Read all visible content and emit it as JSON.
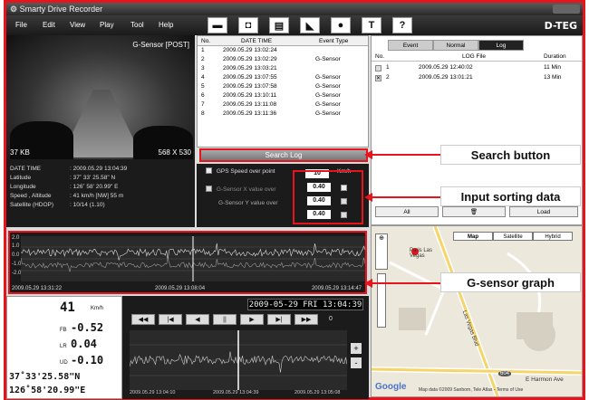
{
  "window": {
    "app_title": "Smarty Drive Recorder",
    "brand": "D-TEG"
  },
  "menu": [
    "File",
    "Edit",
    "View",
    "Play",
    "Tool",
    "Help"
  ],
  "toolbar_icons": [
    "folder-icon",
    "camera-icon",
    "print-icon",
    "flag-icon",
    "disc-icon",
    "pin-icon",
    "help-icon"
  ],
  "toolbar_glyphs": [
    "▬",
    "◘",
    "▤",
    "◣",
    "●",
    "T",
    "?"
  ],
  "video": {
    "channel": "G-Sensor [POST]",
    "size": "37 KB",
    "resolution": "568 X 530"
  },
  "info": {
    "rows": [
      {
        "label": "DATE TIME",
        "value": ": 2009.05.29 13:04:39"
      },
      {
        "label": "Latitude",
        "value": ":  37˚ 33' 25.58\" N"
      },
      {
        "label": "Longitude",
        "value": ":  126˚ 58' 20.99\" E"
      },
      {
        "label": "Speed , Altitude",
        "value": ":  41 km/h  [NW]    55 m"
      },
      {
        "label": "Satellite (HDOP)",
        "value": ":  10/14 (1.10)"
      }
    ]
  },
  "events": {
    "headers": [
      "No.",
      "DATE TIME",
      "Event Type"
    ],
    "rows": [
      {
        "no": "1",
        "dt": "2009.05.29 13:02:24",
        "type": ""
      },
      {
        "no": "2",
        "dt": "2009.05.29 13:02:29",
        "type": "G-Sensor"
      },
      {
        "no": "3",
        "dt": "2009.05.29 13:03:21",
        "type": ""
      },
      {
        "no": "4",
        "dt": "2009.05.29 13:07:55",
        "type": "G-Sensor"
      },
      {
        "no": "5",
        "dt": "2009.05.29 13:07:58",
        "type": "G-Sensor"
      },
      {
        "no": "6",
        "dt": "2009.05.29 13:10:11",
        "type": "G-Sensor"
      },
      {
        "no": "7",
        "dt": "2009.05.29 13:11:08",
        "type": "G-Sensor"
      },
      {
        "no": "8",
        "dt": "2009.05.29 13:11:36",
        "type": "G-Sensor"
      }
    ]
  },
  "search": {
    "label": "Search Log"
  },
  "filters": {
    "speed_label": "GPS Speed over point",
    "speed_value": "10",
    "speed_unit": "Km/h",
    "x_label": "G-Sensor X value over",
    "x_value": "0.40",
    "y_label": "G-Sensor Y value over",
    "y_value": "0.40",
    "z_value": "0.40"
  },
  "log": {
    "tabs": [
      "Event",
      "Normal",
      "Log"
    ],
    "active_tab": "Log",
    "headers": [
      "No.",
      "LOG File",
      "Duration"
    ],
    "rows": [
      {
        "no": "1",
        "file": "2009.05.29 12:40:02",
        "duration": "11 Min",
        "checked": false
      },
      {
        "no": "2",
        "file": "2009.05.29 13:01:21",
        "duration": "13 Min",
        "checked": true
      }
    ],
    "buttons": [
      "All",
      "Load"
    ]
  },
  "graph": {
    "y_ticks": [
      "2.0",
      "1.0",
      "0.0",
      "-1.0",
      "-2.0"
    ],
    "times": [
      "2009.05.29 13:31:22",
      "2009.05.29 13:08:04",
      "2009.05.29 13:14:47"
    ]
  },
  "map": {
    "types": [
      "Map",
      "Satellite",
      "Hybrid"
    ],
    "labels": [
      "Paris Las Vegas",
      "Las Vegas Blvd",
      "E Harmon Ave"
    ],
    "shield": "604",
    "google": "Google",
    "copyright": "Map data ©2009 Sanborn, Tele Atlas - Terms of Use"
  },
  "speed": {
    "value": "41",
    "unit": "Km/h",
    "fb_label": "FB",
    "fb": "-0.52",
    "lr_label": "LR",
    "lr": "0.04",
    "ud_label": "UD",
    "ud": "-0.10",
    "lat": "37˚33'25.58\"N",
    "lon": "126˚58'20.99\"E"
  },
  "player": {
    "clock": "2009-05-29 FRI 13:04:39",
    "buttons": [
      "◀◀",
      "|◀",
      "◀",
      "||",
      "▶",
      "▶|",
      "▶▶"
    ],
    "speed": "0",
    "times": [
      "2009.05.29 13:04:10",
      "2009.05.29 13:04:39",
      "2009.05.29 13:05:08"
    ],
    "zoom": [
      "+",
      "-"
    ]
  },
  "callouts": {
    "search": "Search button",
    "inputs": "Input sorting data",
    "graph": "G-sensor graph"
  },
  "colors": {
    "accent": "#e8141c",
    "panel": "#1b1b1b"
  }
}
